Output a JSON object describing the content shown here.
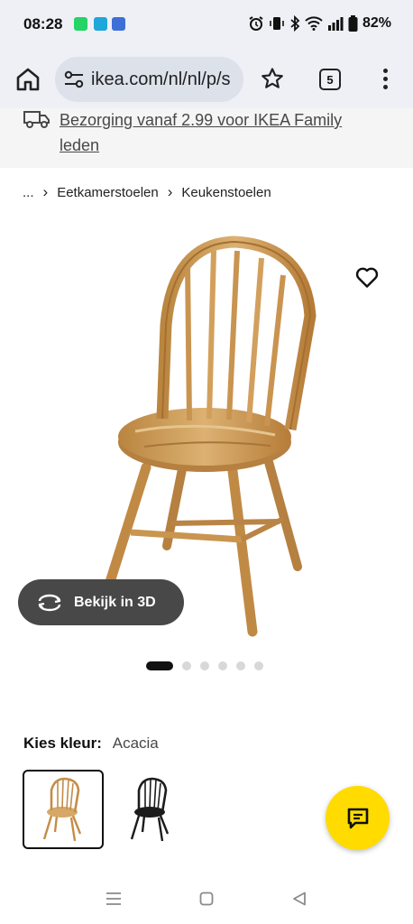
{
  "status_bar": {
    "time": "08:28",
    "battery_pct": "82%",
    "app_icons": [
      {
        "icon": "whatsapp-icon",
        "color": "#25d366"
      },
      {
        "icon": "app-icon",
        "color": "#1ea7d8"
      },
      {
        "icon": "shield-app-icon",
        "color": "#3d6fd6"
      }
    ]
  },
  "browser": {
    "url": "ikea.com/nl/nl/p/s",
    "tab_count": "5"
  },
  "banner": {
    "text": "Bezorging vanaf 2.99 voor IKEA Family leden"
  },
  "breadcrumb": {
    "items": [
      "...",
      "Eetkamerstoelen",
      "Keukenstoelen"
    ]
  },
  "product": {
    "view_3d_label": "Bekijk in 3D",
    "image_count": 6,
    "active_image_index": 0,
    "color_label": "Kies kleur:",
    "color_value": "Acacia",
    "swatches": [
      {
        "color": "#c99a57",
        "selected": true
      },
      {
        "color": "#1c1c1c",
        "selected": false
      }
    ]
  },
  "colors": {
    "chat_button": "#ffdb00",
    "dark_button": "#484848"
  }
}
